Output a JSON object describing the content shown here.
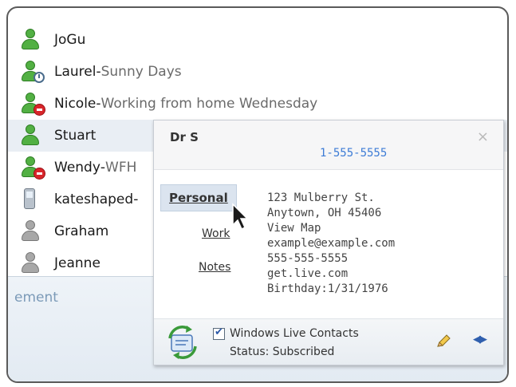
{
  "contacts": [
    {
      "name": "JoGu",
      "separator": "",
      "status": "",
      "icon": "person-online-icon",
      "selected": false
    },
    {
      "name": "Laurel",
      "separator": " - ",
      "status": "Sunny Days",
      "icon": "person-away-icon",
      "selected": false
    },
    {
      "name": "Nicole",
      "separator": " - ",
      "status": "Working from home Wednesday",
      "icon": "person-busy-icon",
      "selected": false
    },
    {
      "name": "Stuart",
      "separator": "",
      "status": "",
      "icon": "person-online-icon",
      "selected": true
    },
    {
      "name": "Wendy",
      "separator": " - ",
      "status": "WFH",
      "icon": "person-busy-icon",
      "selected": false
    },
    {
      "name": "kateshaped",
      "separator": " -",
      "status": "",
      "icon": "mobile-phone-icon",
      "selected": false
    },
    {
      "name": "Graham",
      "separator": "",
      "status": "",
      "icon": "person-offline-icon",
      "selected": false
    },
    {
      "name": "Jeanne",
      "separator": "",
      "status": "",
      "icon": "person-offline-icon",
      "selected": false
    }
  ],
  "bottom_link": "ement",
  "card": {
    "name": "Dr S",
    "close": "×",
    "phone": "1-555-5555",
    "tabs": {
      "personal": "Personal",
      "work": "Work",
      "notes": "Notes"
    },
    "personal": {
      "address_line1": "123 Mulberry St.",
      "address_line2": "Anytown, OH 45406",
      "map_link": "View Map"
    },
    "notes": {
      "email": "example@example.com",
      "phone": "555-555-5555",
      "website": "get.live.com",
      "birthday": "Birthday:1/31/1976"
    },
    "footer": {
      "source": "Windows Live Contacts",
      "status": "Status: Subscribed",
      "checked": true
    }
  },
  "colors": {
    "accent_link": "#3d7cd6",
    "online": "#52b043",
    "busy": "#d8262b",
    "offline": "#a8a8a8"
  }
}
